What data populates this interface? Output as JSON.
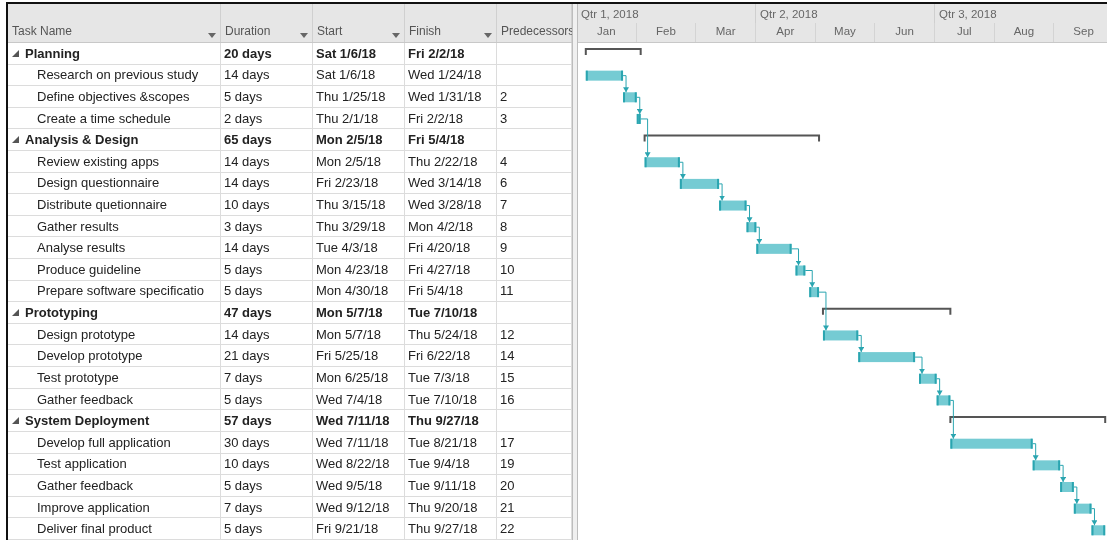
{
  "columns": [
    {
      "label": "Task Name",
      "dropdown": true
    },
    {
      "label": "Duration",
      "dropdown": true
    },
    {
      "label": "Start",
      "dropdown": true
    },
    {
      "label": "Finish",
      "dropdown": true
    },
    {
      "label": "Predecessors"
    }
  ],
  "timescale": {
    "quarters": [
      "Qtr 1, 2018",
      "Qtr 2, 2018",
      "Qtr 3, 2018"
    ],
    "months": [
      "Jan",
      "Feb",
      "Mar",
      "Apr",
      "May",
      "Jun",
      "Jul",
      "Aug",
      "Sep"
    ]
  },
  "tasks": [
    {
      "name": "Planning",
      "duration": "20 days",
      "start": "Sat 1/6/18",
      "finish": "Fri 2/2/18",
      "expanded": true,
      "children": [
        {
          "name": "Research on previous study",
          "duration": "14 days",
          "start": "Sat 1/6/18",
          "finish": "Wed 1/24/18"
        },
        {
          "name": "Define objectives &scopes",
          "duration": "5 days",
          "start": "Thu 1/25/18",
          "finish": "Wed 1/31/18",
          "predecessors": "2"
        },
        {
          "name": "Create a time schedule",
          "duration": "2 days",
          "start": "Thu 2/1/18",
          "finish": "Fri 2/2/18",
          "predecessors": "3"
        }
      ]
    },
    {
      "name": "Analysis & Design",
      "duration": "65 days",
      "start": "Mon 2/5/18",
      "finish": "Fri 5/4/18",
      "expanded": true,
      "children": [
        {
          "name": "Review existing apps",
          "duration": "14 days",
          "start": "Mon 2/5/18",
          "finish": "Thu 2/22/18",
          "predecessors": "4"
        },
        {
          "name": "Design questionnaire",
          "duration": "14 days",
          "start": "Fri 2/23/18",
          "finish": "Wed 3/14/18",
          "predecessors": "6"
        },
        {
          "name": "Distribute quetionnaire",
          "duration": "10 days",
          "start": "Thu 3/15/18",
          "finish": "Wed 3/28/18",
          "predecessors": "7"
        },
        {
          "name": "Gather results",
          "duration": "3 days",
          "start": "Thu 3/29/18",
          "finish": "Mon 4/2/18",
          "predecessors": "8"
        },
        {
          "name": "Analyse results",
          "duration": "14 days",
          "start": "Tue 4/3/18",
          "finish": "Fri 4/20/18",
          "predecessors": "9"
        },
        {
          "name": "Produce guideline",
          "duration": "5 days",
          "start": "Mon 4/23/18",
          "finish": "Fri 4/27/18",
          "predecessors": "10"
        },
        {
          "name": "Prepare software specificatio",
          "duration": "5 days",
          "start": "Mon 4/30/18",
          "finish": "Fri 5/4/18",
          "predecessors": "11"
        }
      ]
    },
    {
      "name": "Prototyping",
      "duration": "47 days",
      "start": "Mon 5/7/18",
      "finish": "Tue 7/10/18",
      "expanded": true,
      "children": [
        {
          "name": "Design prototype",
          "duration": "14 days",
          "start": "Mon 5/7/18",
          "finish": "Thu 5/24/18",
          "predecessors": "12"
        },
        {
          "name": "Develop prototype",
          "duration": "21 days",
          "start": "Fri 5/25/18",
          "finish": "Fri 6/22/18",
          "predecessors": "14"
        },
        {
          "name": "Test prototype",
          "duration": "7 days",
          "start": "Mon 6/25/18",
          "finish": "Tue 7/3/18",
          "predecessors": "15"
        },
        {
          "name": "Gather feedback",
          "duration": "5 days",
          "start": "Wed 7/4/18",
          "finish": "Tue 7/10/18",
          "predecessors": "16"
        }
      ]
    },
    {
      "name": "System Deployment",
      "duration": "57 days",
      "start": "Wed 7/11/18",
      "finish": "Thu 9/27/18",
      "expanded": true,
      "children": [
        {
          "name": "Develop full application",
          "duration": "30 days",
          "start": "Wed 7/11/18",
          "finish": "Tue 8/21/18",
          "predecessors": "17"
        },
        {
          "name": "Test application",
          "duration": "10 days",
          "start": "Wed 8/22/18",
          "finish": "Tue 9/4/18",
          "predecessors": "19"
        },
        {
          "name": "Gather feedback",
          "duration": "5 days",
          "start": "Wed 9/5/18",
          "finish": "Tue 9/11/18",
          "predecessors": "20"
        },
        {
          "name": "Improve application",
          "duration": "7 days",
          "start": "Wed 9/12/18",
          "finish": "Thu 9/20/18",
          "predecessors": "21"
        },
        {
          "name": "Deliver final product",
          "duration": "5 days",
          "start": "Fri 9/21/18",
          "finish": "Thu 9/27/18",
          "predecessors": "22"
        }
      ]
    }
  ]
}
